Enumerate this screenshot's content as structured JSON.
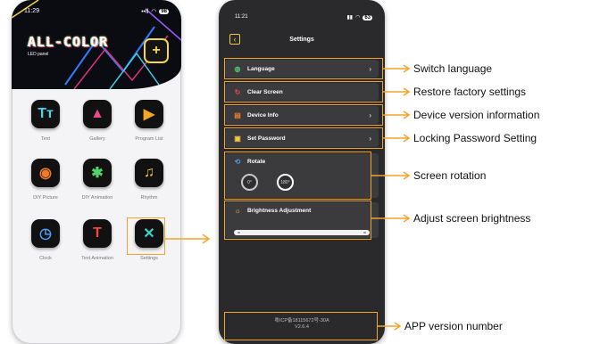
{
  "home": {
    "status_time": "11:29",
    "status_signal": "••ll",
    "status_battery": "98",
    "logo_text": "ALL-COLOR",
    "logo_subtext": "LED panel",
    "add_symbol": "+",
    "apps": [
      {
        "label": "Text",
        "glyph": "Tт"
      },
      {
        "label": "Gallery",
        "glyph": "▲"
      },
      {
        "label": "Program List",
        "glyph": "▶"
      },
      {
        "label": "DIY Picture",
        "glyph": "◉"
      },
      {
        "label": "DIY Animation",
        "glyph": "✱"
      },
      {
        "label": "Rhythm",
        "glyph": "♫"
      },
      {
        "label": "Clock",
        "glyph": "◷"
      },
      {
        "label": "Text Animation",
        "glyph": "T"
      },
      {
        "label": "Settings",
        "glyph": "✕"
      }
    ]
  },
  "settings": {
    "status_time": "11:21",
    "status_battery": "63",
    "back_symbol": "‹",
    "title": "Settings",
    "rows": {
      "language": "Language",
      "clear_screen": "Clear Screen",
      "device_info": "Device Info",
      "set_password": "Set Password"
    },
    "rotate": {
      "label": "Rotate",
      "option_0": "0°",
      "option_180": "180°"
    },
    "brightness": {
      "label": "Brightness Adjustment",
      "level": 0.5
    },
    "footer": {
      "icp": "粤ICP备18115672号-30A",
      "version": "V2.6.4"
    }
  },
  "callouts": {
    "language": "Switch language",
    "clear_screen": "Restore factory settings",
    "device_info": "Device version information",
    "set_password": "Locking Password Setting",
    "rotate": "Screen rotation",
    "brightness": "Adjust screen brightness",
    "version": "APP version number"
  },
  "colors": {
    "accent": "#f2a42a",
    "dark_bg": "#2a2a2c",
    "card_bg": "#3b3b3d"
  }
}
